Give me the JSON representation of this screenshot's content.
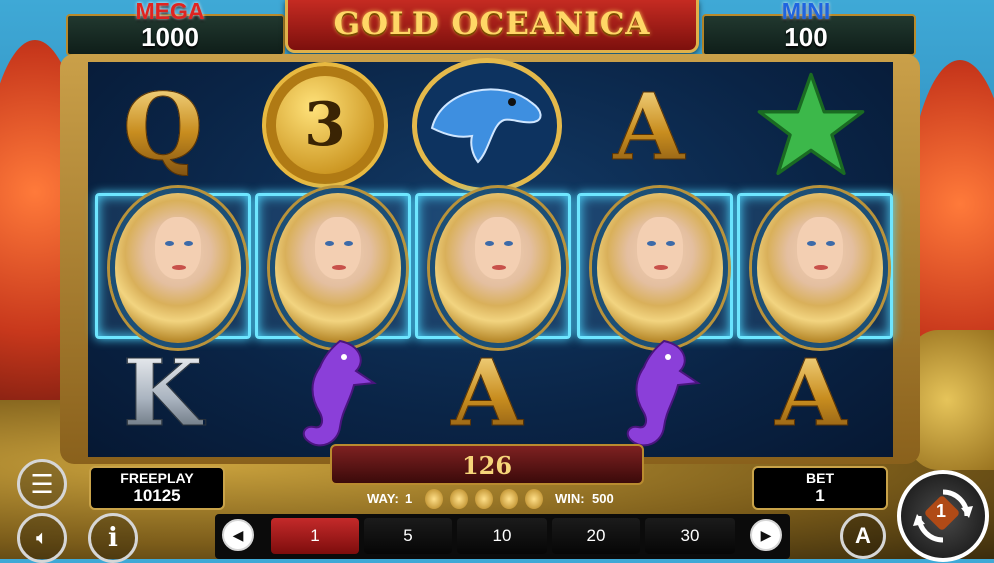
{
  "jackpots": {
    "mega": {
      "label": "MEGA",
      "value": "1000",
      "color": "#e02420"
    },
    "mini": {
      "label": "MINI",
      "value": "100",
      "color": "#1e64e0"
    }
  },
  "title": "GOLD OCEANICA",
  "reels": {
    "row1": [
      "Q",
      "3",
      "dolphin",
      "A",
      "starfish"
    ],
    "row2": [
      "goddess",
      "goddess",
      "goddess",
      "goddess",
      "goddess"
    ],
    "row3": [
      "K",
      "seahorse",
      "A",
      "seahorse",
      "A"
    ]
  },
  "win_amount": "126",
  "freeplay": {
    "label": "FREEPLAY",
    "value": "10125"
  },
  "bet": {
    "label": "BET",
    "value": "1"
  },
  "way": {
    "label": "WAY:",
    "value": "1"
  },
  "win": {
    "label": "WIN:",
    "value": "500"
  },
  "bet_options": [
    "1",
    "5",
    "10",
    "20",
    "30"
  ],
  "selected_bet": "1",
  "controls": {
    "autoplay_symbol": "A",
    "spin_badge": "1"
  }
}
